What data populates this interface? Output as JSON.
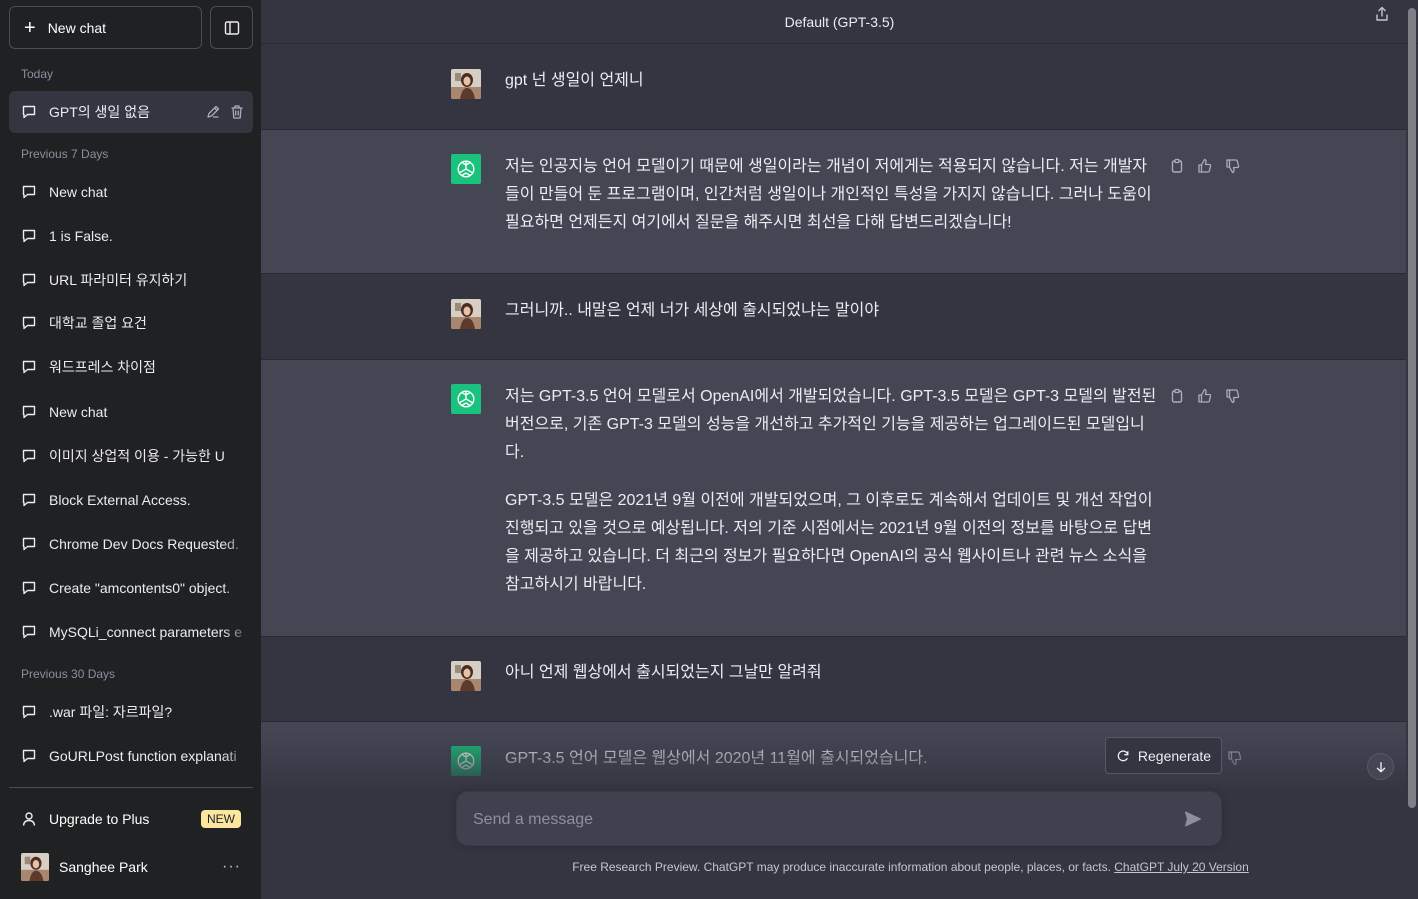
{
  "sidebar": {
    "new_chat_label": "New chat",
    "sections": [
      {
        "label": "Today"
      },
      {
        "label": "Previous 7 Days"
      },
      {
        "label": "Previous 30 Days"
      }
    ],
    "items": [
      {
        "title": "GPT의 생일 없음"
      },
      {
        "title": "New chat"
      },
      {
        "title": "1 is False."
      },
      {
        "title": "URL 파라미터 유지하기"
      },
      {
        "title": "대학교 졸업 요건"
      },
      {
        "title": "워드프레스 차이점"
      },
      {
        "title": "New chat"
      },
      {
        "title": "이미지 상업적 이용 - 가능한 U"
      },
      {
        "title": "Block External Access."
      },
      {
        "title": "Chrome Dev Docs Requested."
      },
      {
        "title": "Create \"amcontents0\" object."
      },
      {
        "title": "MySQLi_connect parameters e"
      },
      {
        "title": ".war 파일: 자르파일?"
      },
      {
        "title": "GoURLPost function explanati"
      }
    ],
    "upgrade_label": "Upgrade to Plus",
    "new_badge": "NEW",
    "user_name": "Sanghee Park",
    "more_label": "···"
  },
  "header": {
    "model_title": "Default (GPT-3.5)"
  },
  "messages": [
    {
      "role": "user",
      "paragraphs": [
        "gpt 넌 생일이 언제니"
      ]
    },
    {
      "role": "assistant",
      "paragraphs": [
        "저는 인공지능 언어 모델이기 때문에 생일이라는 개념이 저에게는 적용되지 않습니다. 저는 개발자들이 만들어 둔 프로그램이며, 인간처럼 생일이나 개인적인 특성을 가지지 않습니다. 그러나 도움이 필요하면 언제든지 여기에서 질문을 해주시면 최선을 다해 답변드리겠습니다!"
      ]
    },
    {
      "role": "user",
      "paragraphs": [
        "그러니까.. 내말은 언제 너가 세상에 출시되었냐는 말이야"
      ]
    },
    {
      "role": "assistant",
      "paragraphs": [
        "저는 GPT-3.5 언어 모델로서 OpenAI에서 개발되었습니다. GPT-3.5 모델은 GPT-3 모델의 발전된 버전으로, 기존 GPT-3 모델의 성능을 개선하고 추가적인 기능을 제공하는 업그레이드된 모델입니다.",
        "GPT-3.5 모델은 2021년 9월 이전에 개발되었으며, 그 이후로도 계속해서 업데이트 및 개선 작업이 진행되고 있을 것으로 예상됩니다. 저의 기준 시점에서는 2021년 9월 이전의 정보를 바탕으로 답변을 제공하고 있습니다. 더 최근의 정보가 필요하다면 OpenAI의 공식 웹사이트나 관련 뉴스 소식을 참고하시기 바랍니다."
      ]
    },
    {
      "role": "user",
      "paragraphs": [
        "아니 언제 웹상에서 출시되었는지 그날만 알려줘"
      ]
    },
    {
      "role": "assistant",
      "paragraphs": [
        "GPT-3.5 언어 모델은 웹상에서 2020년 11월에 출시되었습니다."
      ]
    }
  ],
  "composer": {
    "placeholder": "Send a message",
    "regenerate_label": "Regenerate"
  },
  "footer": {
    "text": "Free Research Preview. ChatGPT may produce inaccurate information about people, places, or facts. ",
    "link": "ChatGPT July 20 Version"
  },
  "colors": {
    "sidebar_bg": "#202123",
    "main_bg": "#343541",
    "assistant_bg": "#444654",
    "gpt_green": "#19c37d",
    "new_badge": "#fae69e"
  }
}
